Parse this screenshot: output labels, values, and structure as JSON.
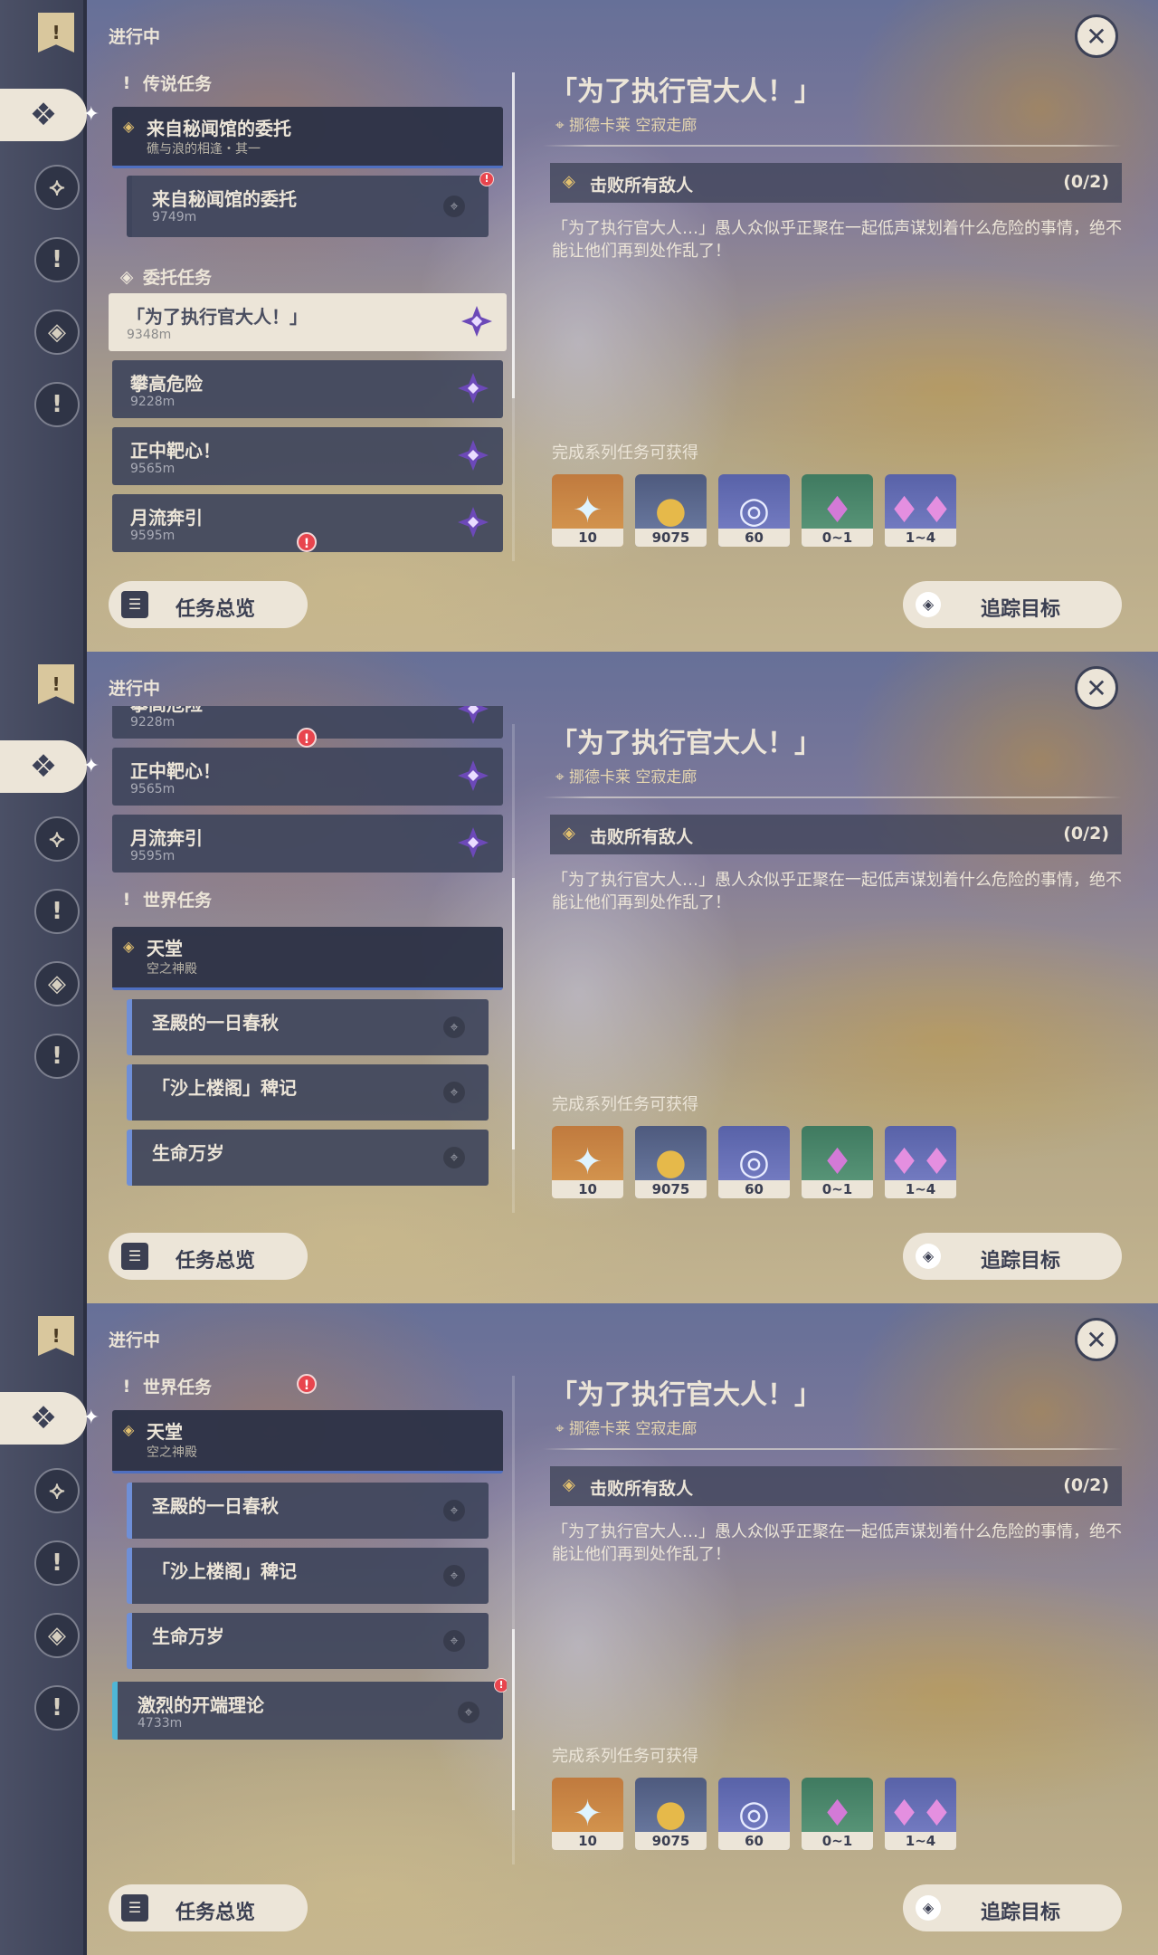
{
  "status_label": "进行中",
  "detail": {
    "title": "「为了执行官大人！」",
    "location": "挪德卡莱 空寂走廊",
    "objective": "击败所有敌人",
    "objective_progress": "(0/2)",
    "description": "「为了执行官大人…」愚人众似乎正聚在一起低声谋划着什么危险的事情，绝不能让他们再到处作乱了！",
    "reward_label": "完成系列任务可获得",
    "rewards": [
      {
        "name": "primogem-icon",
        "count": "10"
      },
      {
        "name": "mora-icon",
        "count": "9075"
      },
      {
        "name": "adventure-exp-icon",
        "count": "60"
      },
      {
        "name": "crystal-icon",
        "count": "0~1"
      },
      {
        "name": "crystal-cluster-icon",
        "count": "1~4"
      }
    ],
    "track_button": "追踪目标"
  },
  "overview_button": "任务总览",
  "categories": {
    "legend": "传说任务",
    "commission": "委托任务",
    "world": "世界任务"
  },
  "legend_group": {
    "title": "来自秘闻馆的委托",
    "subtitle": "礁与浪的相逢・其一"
  },
  "legend_sub": {
    "title": "来自秘闻馆的委托",
    "distance": "9749m"
  },
  "commissions": [
    {
      "title": "「为了执行官大人！」",
      "distance": "9348m"
    },
    {
      "title": "攀高危险",
      "distance": "9228m"
    },
    {
      "title": "正中靶心！",
      "distance": "9565m"
    },
    {
      "title": "月流奔引",
      "distance": "9595m"
    }
  ],
  "world_group": {
    "title": "天堂",
    "subtitle": "空之神殿"
  },
  "world_subs": [
    {
      "title": "圣殿的一日春秋"
    },
    {
      "title": "「沙上楼阁」稗记"
    },
    {
      "title": "生命万岁"
    }
  ],
  "extra_quest": {
    "title": "激烈的开端理论",
    "distance": "4733m"
  }
}
